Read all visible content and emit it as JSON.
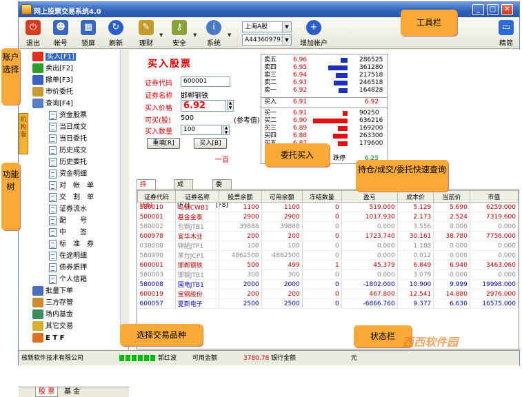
{
  "window": {
    "title": "网上股票交易系统4.0"
  },
  "toolbar": {
    "items": [
      {
        "label": "退出",
        "icon": "exit-icon",
        "color": "#d83c20"
      },
      {
        "label": "帐号",
        "icon": "users-icon",
        "color": "#3a67c0"
      },
      {
        "label": "锁屏",
        "icon": "lock-icon",
        "color": "#3a67c0"
      },
      {
        "label": "刷新",
        "icon": "refresh-icon",
        "color": "#2a5dc8"
      },
      {
        "label": "理财",
        "icon": "notebook-icon",
        "color": "#8a6a20"
      },
      {
        "label": "安全",
        "icon": "key-icon",
        "color": "#6a8c2a"
      },
      {
        "label": "系统",
        "icon": "info-icon",
        "color": "#4a79c8"
      },
      {
        "label": "增加帐户",
        "icon": "add-user-icon",
        "color": "#2a5dc8"
      },
      {
        "label": "精简",
        "icon": "compact-icon",
        "color": "#2a6bd8"
      }
    ],
    "market": "上海A股",
    "account": "A443609791"
  },
  "tree": {
    "items": [
      {
        "label": "买入[F1]",
        "icon": "buy-icon",
        "selected": true
      },
      {
        "label": "卖出[F2]",
        "icon": "sell-icon"
      },
      {
        "label": "撤单[F3]",
        "icon": "cancel-order-icon"
      },
      {
        "label": "市价委托",
        "icon": "market-order-icon"
      },
      {
        "label": "查询[F4]",
        "icon": "query-icon"
      }
    ],
    "sub": [
      "资金股票",
      "当日成交",
      "当日委托",
      "历史成交",
      "历史委托",
      "资金明细",
      "对　帐　单",
      "交　割　单",
      "证券流水",
      "配　　号",
      "中　　签",
      "标　准　券",
      "在途明细",
      "债券质押",
      "个人信箱"
    ],
    "bottom": [
      "批量下单",
      "三方存管",
      "场内基金",
      "其它交易",
      "E T F"
    ],
    "tabs": [
      "股 票",
      "基 金"
    ]
  },
  "form": {
    "title": "买入股票",
    "code_label": "证券代码",
    "code": "600001",
    "name_label": "证券名称",
    "name": "邯郸钢铁",
    "price_label": "买入价格",
    "price": "6.92",
    "avail_label": "可买(股)",
    "avail": "500",
    "ref": "(参考值)",
    "qty_label": "买入数量",
    "qty": "100",
    "reset_btn": "重填[R]",
    "buy_btn": "买入[B]",
    "unit": "一百"
  },
  "quotes": {
    "sell": [
      {
        "label": "卖五",
        "price": "6.96",
        "vol": "286525",
        "bar": 0.2
      },
      {
        "label": "卖四",
        "price": "6.95",
        "vol": "361280",
        "bar": 0.57
      },
      {
        "label": "卖三",
        "price": "6.94",
        "vol": "217518",
        "bar": 0.34
      },
      {
        "label": "卖二",
        "price": "6.93",
        "vol": "246518",
        "bar": 0.39
      },
      {
        "label": "卖一",
        "price": "6.92",
        "vol": "164828",
        "bar": 0.26
      }
    ],
    "buy_label": "买入",
    "buy_price": "6.91",
    "buy_price2": "6.92",
    "buy": [
      {
        "label": "买一",
        "price": "6.91",
        "vol": "90250",
        "bar": 0.14
      },
      {
        "label": "买二",
        "price": "6.90",
        "vol": "636216",
        "bar": 1.0
      },
      {
        "label": "买三",
        "price": "6.89",
        "vol": "169200",
        "bar": 0.27
      },
      {
        "label": "买四",
        "price": "6.88",
        "vol": "263300",
        "bar": 0.41
      },
      {
        "label": "买五",
        "price": "6.87",
        "vol": "179600",
        "bar": 0.28
      }
    ],
    "limit_label": "跌停",
    "limit": "6.25"
  },
  "tabs": [
    "持仓 [F6]",
    "成交 [F7]",
    "委托 [F8]"
  ],
  "grid": {
    "headers": [
      "证券代码",
      "证券名称",
      "股票余额",
      "可用余额",
      "冻结数量",
      "盈亏",
      "成本价",
      "当前价",
      "市值"
    ],
    "rows": [
      [
        "580010",
        "马钢CWB1",
        "1100",
        "1100",
        "0",
        "519.000",
        "5.129",
        "5.690",
        "6259.000",
        "#c00000"
      ],
      [
        "500001",
        "基金金泰",
        "2900",
        "2900",
        "0",
        "1017.930",
        "2.173",
        "2.524",
        "7319.600",
        "#c00000"
      ],
      [
        "580002",
        "包钢JTB1",
        "39888",
        "39888",
        "0",
        "0.000",
        "3.556",
        "0.000",
        "0.000",
        "#888888"
      ],
      [
        "600978",
        "宜华木业",
        "200",
        "200",
        "0",
        "1723.740",
        "30.161",
        "38.780",
        "7756.000",
        "#c00000"
      ],
      [
        "038008",
        "钾肥JTP1",
        "100",
        "100",
        "0",
        "0.000",
        "1.188",
        "0.000",
        "0.000",
        "#888888"
      ],
      [
        "580990",
        "茅台JCP1",
        "4862500",
        "4862500",
        "0",
        "0.000",
        "0.012",
        "0.000",
        "0.000",
        "#888888"
      ],
      [
        "600001",
        "邯郸钢铁",
        "500",
        "499",
        "1",
        "45.379",
        "6.849",
        "6.940",
        "3463.060",
        "#c00000"
      ],
      [
        "580003",
        "邯钢JTB1",
        "300",
        "300",
        "0",
        "0.000",
        "3.079",
        "0.000",
        "0.000",
        "#888888"
      ],
      [
        "580008",
        "国电JTB1",
        "2000",
        "2000",
        "0",
        "-1802.000",
        "10.900",
        "9.999",
        "19998.000",
        "#0000c0"
      ],
      [
        "600019",
        "宝钢股份",
        "200",
        "200",
        "0",
        "467.800",
        "12.541",
        "14.880",
        "2976.000",
        "#c00000"
      ],
      [
        "600057",
        "夏新电子",
        "2500",
        "2500",
        "0",
        "-6866.760",
        "9.377",
        "6.630",
        "16575.000",
        "#0000c0"
      ]
    ]
  },
  "status": {
    "company": "核新软件技术有限公司",
    "user": "郭红波",
    "avail_label": "可用金额",
    "avail": "3780.78",
    "bank_label": "银行金额",
    "unit": "元"
  },
  "callouts": {
    "toolbar": "工具栏",
    "account": "账户选择",
    "tree": "功能树",
    "order": "委托买入",
    "query": "持仓/成交/委托快速查询",
    "variety": "选择交易品种",
    "status": "状态栏",
    "side_tab": "机构版"
  },
  "watermark": "西西软件园"
}
